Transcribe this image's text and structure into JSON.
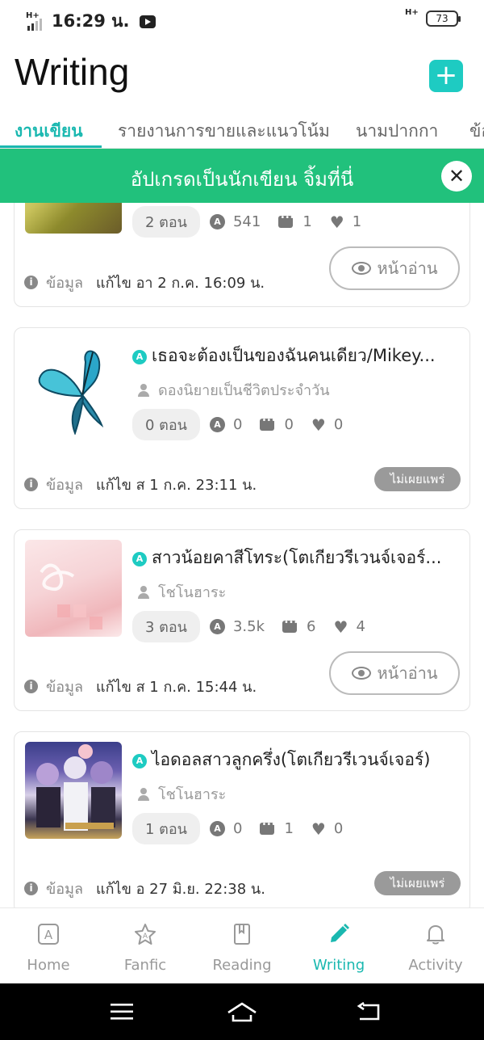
{
  "status_bar": {
    "time": "16:29 น.",
    "network": "H+",
    "battery": "73"
  },
  "header": {
    "title": "Writing",
    "add_icon": "plus-icon"
  },
  "tabs": [
    {
      "label": "งานเขียน",
      "active": true
    },
    {
      "label": "รายงานการขายและแนวโน้ม",
      "active": false
    },
    {
      "label": "นามปากกา",
      "active": false
    },
    {
      "label": "ข้อ",
      "active": false
    }
  ],
  "banner": {
    "text": "อัปเกรดเป็นนักเขียน จิ้มที่นี่",
    "color": "#21c17c"
  },
  "stories": [
    {
      "title": "",
      "author": "",
      "episodes": "2 ตอน",
      "views": "541",
      "comments": "1",
      "likes": "1",
      "info_label": "ข้อมูล",
      "edited": "แก้ไข อา 2 ก.ค. 16:09 น.",
      "action": "หน้าอ่าน",
      "published": true
    },
    {
      "title": "เธอจะต้องเป็นของฉันคนเดียว/Mikey...",
      "author": "ดองนิยายเป็นชีวิตประจำวัน",
      "episodes": "0 ตอน",
      "views": "0",
      "comments": "0",
      "likes": "0",
      "info_label": "ข้อมูล",
      "edited": "แก้ไข ส 1 ก.ค. 23:11 น.",
      "action": "ไม่เผยแพร่",
      "published": false
    },
    {
      "title": "สาวน้อยคาสีโทระ(โตเกียวรีเวนจ์เจอร์...",
      "author": "โชโนฮาระ",
      "episodes": "3 ตอน",
      "views": "3.5k",
      "comments": "6",
      "likes": "4",
      "info_label": "ข้อมูล",
      "edited": "แก้ไข ส 1 ก.ค. 15:44 น.",
      "action": "หน้าอ่าน",
      "published": true
    },
    {
      "title": "ไอดอลสาวลูกครึ่ง(โตเกียวรีเวนจ์เจอร์)",
      "author": "โชโนฮาระ",
      "episodes": "1 ตอน",
      "views": "0",
      "comments": "1",
      "likes": "0",
      "info_label": "ข้อมูล",
      "edited": "แก้ไข อ 27 มิ.ย. 22:38 น.",
      "action": "ไม่เผยแพร่",
      "published": false
    }
  ],
  "bottom_nav": [
    {
      "label": "Home",
      "icon": "home-a-icon",
      "active": false
    },
    {
      "label": "Fanfic",
      "icon": "fanfic-star-icon",
      "active": false
    },
    {
      "label": "Reading",
      "icon": "book-icon",
      "active": false
    },
    {
      "label": "Writing",
      "icon": "pencil-icon",
      "active": true
    },
    {
      "label": "Activity",
      "icon": "bell-icon",
      "active": false
    }
  ],
  "system_nav": [
    "menu-icon",
    "home-icon",
    "back-icon"
  ],
  "colors": {
    "accent": "#1ab8b0",
    "add_button": "#1ecbc2",
    "banner": "#21c17c",
    "unpublished_badge": "#9a9a9a"
  }
}
